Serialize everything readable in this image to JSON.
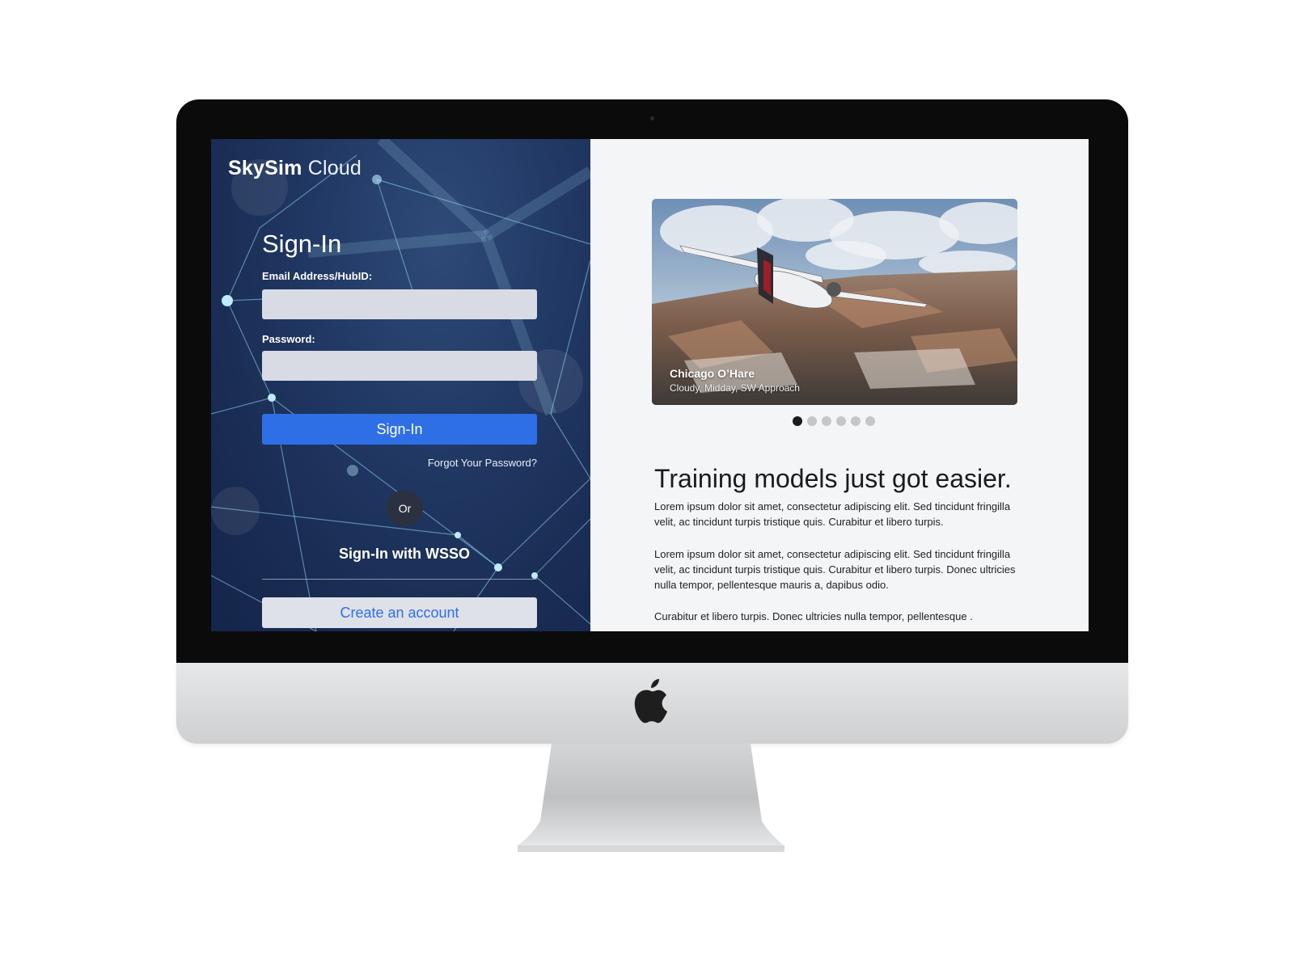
{
  "brand": {
    "name_bold": "SkySim",
    "name_light": "Cloud"
  },
  "signin": {
    "title": "Sign-In",
    "email_label": "Email Address/HubID:",
    "email_value": "",
    "password_label": "Password:",
    "password_value": "",
    "submit_label": "Sign-In",
    "forgot_label": "Forgot Your Password?",
    "or_label": "Or",
    "wsso_label": "Sign-In with WSSO",
    "create_label": "Create an account"
  },
  "carousel": {
    "caption_title": "Chicago O’Hare",
    "caption_subtitle": "Cloudy, Midday, SW Approach",
    "slide_count": 6,
    "active_index": 0
  },
  "content": {
    "headline": "Training models just got easier.",
    "paragraphs": [
      "Lorem ipsum dolor sit amet, consectetur adipiscing elit. Sed tincidunt fringilla velit, ac tincidunt turpis tristique quis. Curabitur et libero turpis.",
      "Lorem ipsum dolor sit amet, consectetur adipiscing elit. Sed tincidunt fringilla velit, ac tincidunt turpis tristique quis. Curabitur et libero turpis. Donec ultricies nulla tempor, pellentesque mauris a, dapibus odio.",
      "Curabitur et libero turpis. Donec ultricies nulla tempor, pellentesque ."
    ]
  },
  "icons": {
    "device_logo": "apple-logo-icon"
  },
  "colors": {
    "primary": "#2e6fe6",
    "left_panel_bg": "#1f3560",
    "right_panel_bg": "#f3f5f7",
    "input_bg": "#d8dae4",
    "active_dot": "#1b1b1b",
    "inactive_dot": "#c4c6ca"
  }
}
